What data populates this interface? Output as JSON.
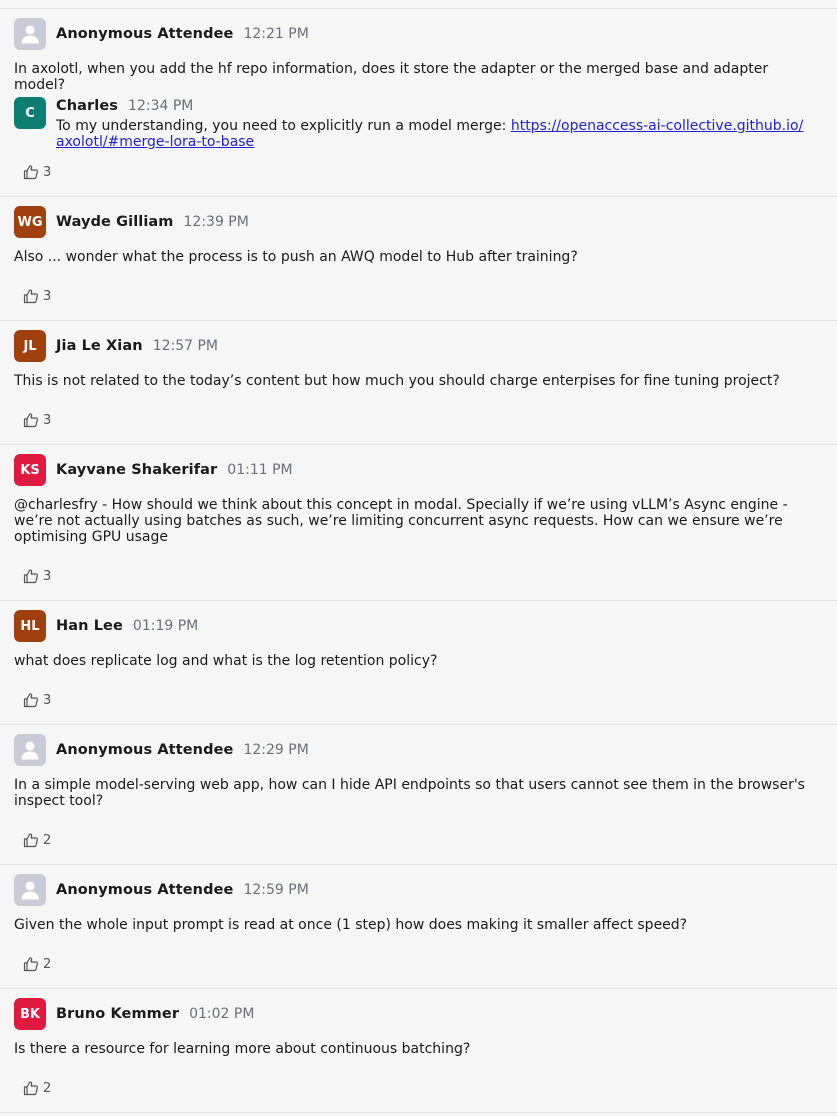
{
  "questions": [
    {
      "name": "Anonymous Attendee",
      "time": "12:21 PM",
      "initials": "",
      "anon": true,
      "color": "#c9ccd6",
      "text": "In axolotl, when you add the hf repo information, does it store the adapter or the merged base and adapter model?",
      "likes": "3",
      "reply": {
        "name": "Charles",
        "time": "12:34 PM",
        "initials": "C",
        "color": "#0e7d72",
        "text_before": "To my understanding, you need to explicitly run a model merge: ",
        "link": "https://openaccess-ai-collective.github.io/axolotl/#merge-lora-to-base",
        "link_line1": "https://openaccess-ai-collective.github.io/",
        "link_line2": "axolotl/#merge-lora-to-base"
      }
    },
    {
      "name": "Wayde Gilliam",
      "time": "12:39 PM",
      "initials": "WG",
      "anon": false,
      "color": "#a0400f",
      "text": "Also ... wonder what the process is to push an AWQ model to Hub after training?",
      "likes": "3"
    },
    {
      "name": "Jia Le Xian",
      "time": "12:57 PM",
      "initials": "JL",
      "anon": false,
      "color": "#a0400f",
      "text": "This is not related to the today’s content but how much you should charge enterpises for fine tuning project?",
      "likes": "3"
    },
    {
      "name": "Kayvane Shakerifar",
      "time": "01:11 PM",
      "initials": "KS",
      "anon": false,
      "color": "#e0193f",
      "text": "@charlesfry - How should we think about this concept in modal. Specially if we’re using vLLM’s Async engine - we’re not actually using batches as such, we’re limiting concurrent async requests. How can we ensure we’re optimising GPU usage",
      "likes": "3"
    },
    {
      "name": "Han Lee",
      "time": "01:19 PM",
      "initials": "HL",
      "anon": false,
      "color": "#a0400f",
      "text": "what does replicate log and what is the log retention policy?",
      "likes": "3"
    },
    {
      "name": "Anonymous Attendee",
      "time": "12:29 PM",
      "initials": "",
      "anon": true,
      "color": "#c9ccd6",
      "text": "In a simple model-serving web app, how can I hide API endpoints so that users cannot see them in the browser's inspect tool?",
      "likes": "2"
    },
    {
      "name": "Anonymous Attendee",
      "time": "12:59 PM",
      "initials": "",
      "anon": true,
      "color": "#c9ccd6",
      "text": "Given the whole input prompt is read at once (1 step) how does making it smaller affect speed?",
      "likes": "2"
    },
    {
      "name": "Bruno Kemmer",
      "time": "01:02 PM",
      "initials": "BK",
      "anon": false,
      "color": "#e0193f",
      "text": "Is there a resource for learning more about continuous batching?",
      "likes": "2"
    }
  ]
}
